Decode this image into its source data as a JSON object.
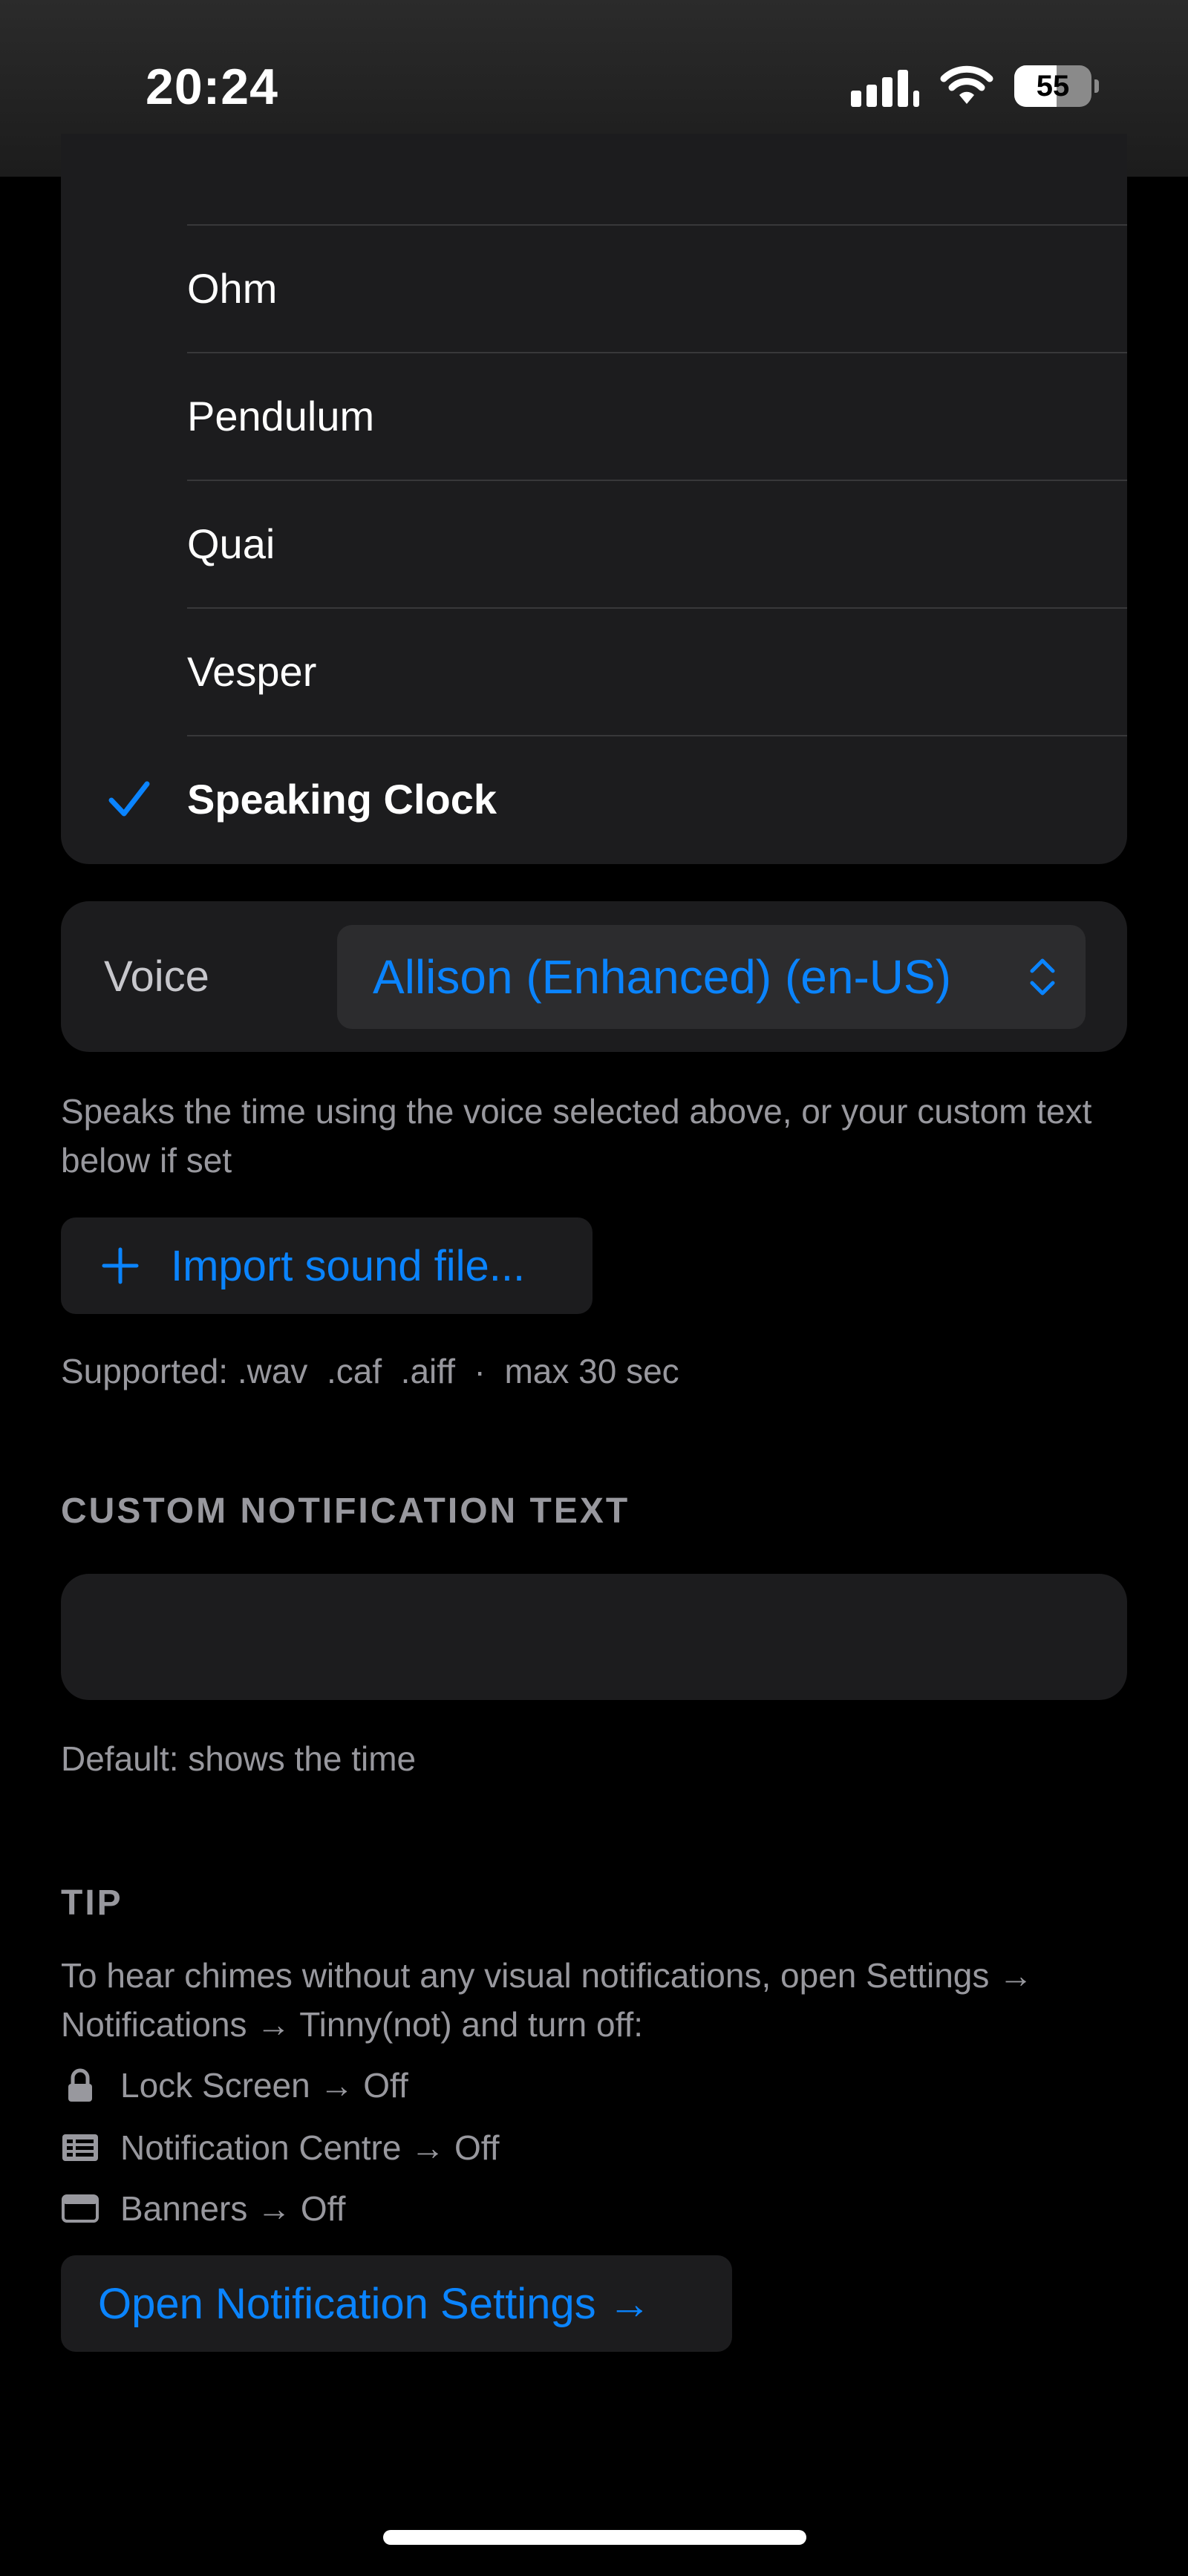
{
  "status_bar": {
    "time": "20:24",
    "battery": "55"
  },
  "sound_list": {
    "items": [
      {
        "label": "Ohm",
        "selected": false
      },
      {
        "label": "Pendulum",
        "selected": false
      },
      {
        "label": "Quai",
        "selected": false
      },
      {
        "label": "Vesper",
        "selected": false
      },
      {
        "label": "Speaking Clock",
        "selected": true
      }
    ]
  },
  "voice": {
    "label": "Voice",
    "value": "Allison (Enhanced) (en-US)"
  },
  "voice_footnote": "Speaks the time using the voice selected above, or your custom text below if set",
  "import": {
    "label": "Import sound file...",
    "supported": "Supported: .wav  .caf  .aiff  ·  max 30 sec"
  },
  "custom_text": {
    "header": "CUSTOM NOTIFICATION TEXT",
    "value": "",
    "footnote": "Default: shows the time"
  },
  "tip": {
    "header": "TIP",
    "body": "To hear chimes without any visual notifications, open Settings → Notifications → Tinny(not) and turn off:",
    "items": [
      {
        "icon": "lock-icon",
        "label": "Lock Screen → Off"
      },
      {
        "icon": "notification-centre-icon",
        "label": "Notification Centre → Off"
      },
      {
        "icon": "banner-icon",
        "label": "Banners → Off"
      }
    ],
    "button": "Open Notification Settings →"
  },
  "colors": {
    "accent": "#0a84ff",
    "card": "#1c1c1e",
    "secondary_text": "#98989e"
  }
}
